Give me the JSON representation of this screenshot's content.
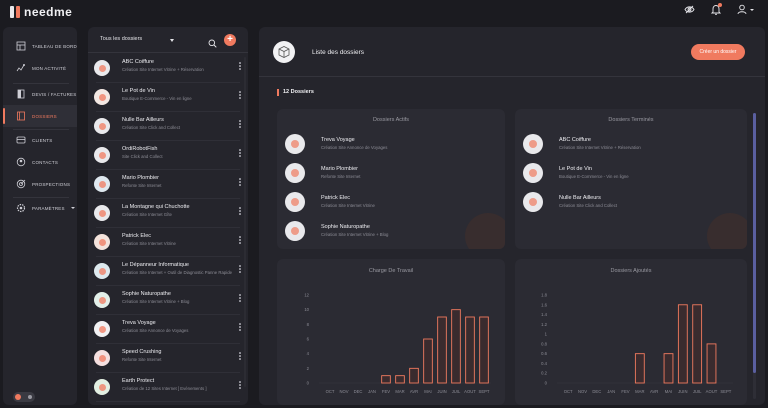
{
  "app": {
    "logo_text": "needme"
  },
  "header_icons": [
    {
      "icon": "eye-slash-icon"
    },
    {
      "icon": "bell-icon"
    },
    {
      "icon": "user-icon"
    }
  ],
  "nav": {
    "items": [
      {
        "label": "TABLEAU DE BORD",
        "icon": "dashboard-icon",
        "active": false
      },
      {
        "label": "MON ACTIVITÉ",
        "icon": "activity-icon",
        "active": false
      },
      {
        "label": "DEVIS / FACTURES",
        "icon": "invoice-icon",
        "active": false
      },
      {
        "label": "DOSSIERS",
        "icon": "folder-icon",
        "active": true
      },
      {
        "label": "CLIENTS",
        "icon": "clients-icon",
        "active": false
      },
      {
        "label": "CONTACTS",
        "icon": "contacts-icon",
        "active": false
      },
      {
        "label": "PROSPECTIONS",
        "icon": "prospection-icon",
        "active": false
      },
      {
        "label": "PARAMÈTRES",
        "icon": "settings-icon",
        "active": false
      }
    ]
  },
  "list": {
    "filter_label": "Tous les dossiers",
    "rows": [
      {
        "name": "ABC Coiffure",
        "desc": "Création Site Internet Vitrine + Réservation",
        "color": "#e9e9ec"
      },
      {
        "name": "Le Pot de Vin",
        "desc": "Boutique E-Commerce - Vin en ligne",
        "color": "#f3e8e3"
      },
      {
        "name": "Nulle Bar Ailleurs",
        "desc": "Création Site Click and Collect",
        "color": "#e9e9ec"
      },
      {
        "name": "OrdiRobotFish",
        "desc": "Site Click and Collect",
        "color": "#e9e9ec"
      },
      {
        "name": "Mario Plombier",
        "desc": "Refonte Site Internet",
        "color": "#dfe8ef"
      },
      {
        "name": "La Montagne qui Chuchotte",
        "desc": "Création Site Internet Gîte",
        "color": "#e9e9ec"
      },
      {
        "name": "Patrick Elec",
        "desc": "Création Site Internet Vitrine",
        "color": "#f4e3dc"
      },
      {
        "name": "Le Dépanneur Informatique",
        "desc": "Création Site Internet + Outil de Diagnostic Panne Rapide",
        "color": "#dde9ee"
      },
      {
        "name": "Sophie Naturopathe",
        "desc": "Création Site Internet Vitrine + Blog",
        "color": "#e2efe9"
      },
      {
        "name": "Treva Voyage",
        "desc": "Création Site Annonce de Voyages",
        "color": "#f1f1f3"
      },
      {
        "name": "Speed Crushing",
        "desc": "Refonte Site Internet",
        "color": "#f5e0e0"
      },
      {
        "name": "Earth Protect",
        "desc": "Création de 12 Sites Internet [ Evénements ]",
        "color": "#e2efe2"
      }
    ]
  },
  "main": {
    "title": "Liste des dossiers",
    "create_button": "Créer un dossier",
    "count_label": "12 Dossiers",
    "active": {
      "title": "Dossiers Actifs",
      "items": [
        {
          "name": "Treva Voyage",
          "desc": "Création Site Annonce de Voyages"
        },
        {
          "name": "Mario Plombier",
          "desc": "Refonte Site Internet"
        },
        {
          "name": "Patrick Elec",
          "desc": "Création Site Internet Vitrine"
        },
        {
          "name": "Sophie Naturopathe",
          "desc": "Création Site Internet Vitrine + Blog"
        }
      ]
    },
    "done": {
      "title": "Dossiers Terminés",
      "items": [
        {
          "name": "ABC Coiffure",
          "desc": "Création Site Internet Vitrine + Réservation"
        },
        {
          "name": "Le Pot de Vin",
          "desc": "Boutique E-Commerce - Vin en ligne"
        },
        {
          "name": "Nulle Bar Ailleurs",
          "desc": "Création Site Click and Collect"
        }
      ]
    }
  },
  "colors": {
    "accent": "#f07a5f",
    "bar_fill": "#3a2b2e",
    "scroll": "#5a5fa0"
  },
  "chart_data": [
    {
      "type": "bar",
      "title": "Charge De Travail",
      "categories": [
        "OCT",
        "NOV",
        "DEC",
        "JAN",
        "FEV",
        "MAR",
        "AVR",
        "MAI",
        "JUIN",
        "JUIL",
        "AOUT",
        "SEPT"
      ],
      "values": [
        0,
        0,
        0,
        0,
        1,
        1,
        2,
        6,
        9,
        10,
        9,
        9
      ],
      "ylim": [
        0,
        12
      ],
      "yticks": [
        0,
        2,
        4,
        6,
        8,
        10,
        12
      ]
    },
    {
      "type": "bar",
      "title": "Dossiers Ajoutés",
      "categories": [
        "OCT",
        "NOV",
        "DEC",
        "JAN",
        "FEV",
        "MAR",
        "AVR",
        "MAI",
        "JUIN",
        "JUIL",
        "AOUT",
        "SEPT"
      ],
      "values": [
        0,
        0,
        0,
        0,
        0,
        0.6,
        0,
        0.6,
        1.6,
        1.6,
        0.8,
        0
      ],
      "ylim": [
        0,
        1.8
      ],
      "yticks": [
        0,
        0.2,
        0.4,
        0.6,
        0.8,
        1.0,
        1.2,
        1.4,
        1.6,
        1.8
      ]
    }
  ]
}
